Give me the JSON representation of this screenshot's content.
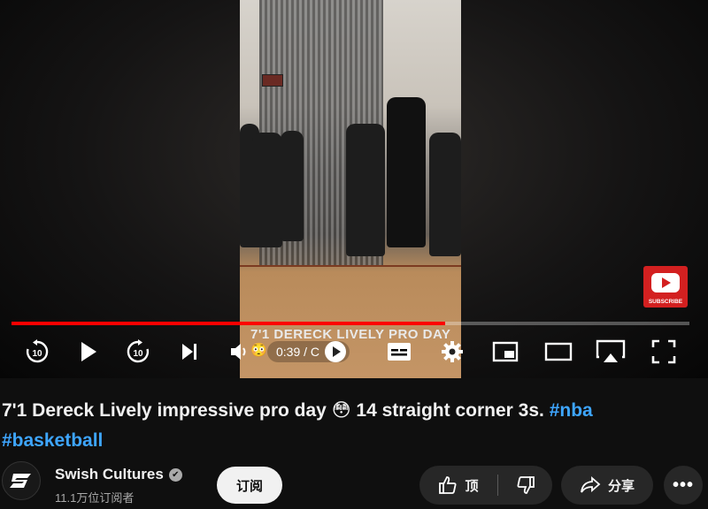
{
  "player": {
    "current_time": "0:39 / C",
    "progress_fraction": 0.64,
    "overlay_caption": "7'1 DERECK LIVELY PRO DAY 😳",
    "watermark_label": "SUBSCRIBE"
  },
  "video": {
    "title_text": "7'1 Dereck Lively impressive pro day 😳 14 straight corner 3s.",
    "tags": [
      "#nba",
      "#basketball"
    ]
  },
  "channel": {
    "name": "Swish Cultures",
    "subscribers": "11.1万位订阅者",
    "verified_icon": "✔"
  },
  "actions": {
    "subscribe_label": "订阅",
    "like_label": "顶",
    "share_label": "分享",
    "more_label": "•••"
  },
  "colors": {
    "progress_played": "#ff0000",
    "tag_link": "#3ea6ff",
    "background": "#0f0f0f"
  }
}
